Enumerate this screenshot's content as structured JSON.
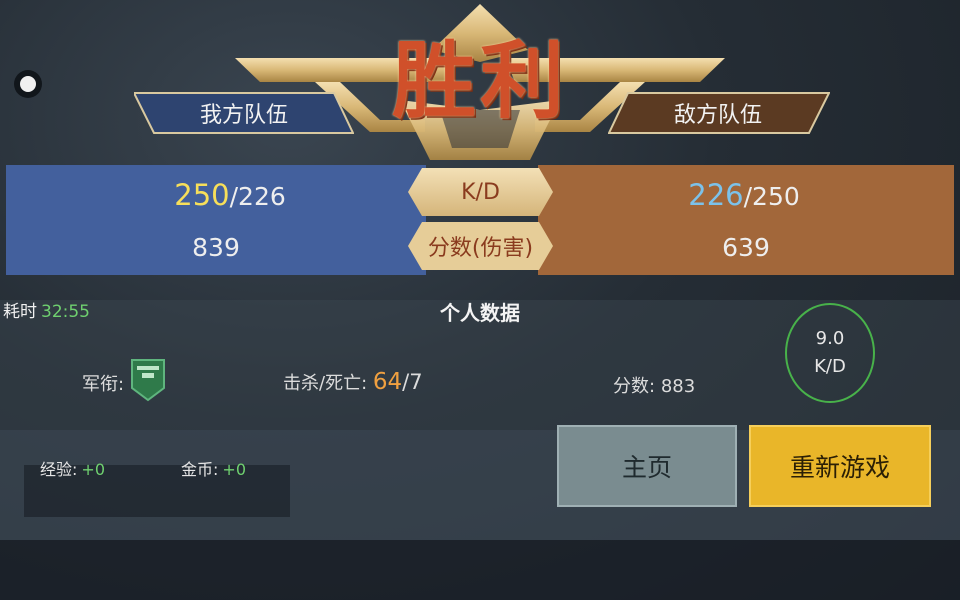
{
  "header": {
    "result_title": "胜利",
    "left_team": "我方队伍",
    "right_team": "敌方队伍"
  },
  "scoreboard": {
    "kd_label": "K/D",
    "score_label": "分数(伤害)",
    "left": {
      "kills": "250",
      "deaths": "/226",
      "score": "839"
    },
    "right": {
      "kills": "226",
      "deaths": "/250",
      "score": "639"
    }
  },
  "personal": {
    "time_label": "耗时",
    "time_value": "32:55",
    "title": "个人数据",
    "kd_value": "9.0",
    "kd_label": "K/D",
    "rank_label": "军衔:",
    "kd_stat_label": "击杀/死亡:",
    "kills": "64",
    "deaths": "/7",
    "score_label": "分数:",
    "score_value": "883"
  },
  "rewards": {
    "exp_label": "经验:",
    "exp_value": "+0",
    "coin_label": "金币:",
    "coin_value": "+0"
  },
  "buttons": {
    "home": "主页",
    "replay": "重新游戏"
  },
  "colors": {
    "ally": "#43609d",
    "enemy": "#a2673a",
    "victory": "#d0502a",
    "gold": "#d9b877",
    "replay_button": "#e9b629"
  }
}
